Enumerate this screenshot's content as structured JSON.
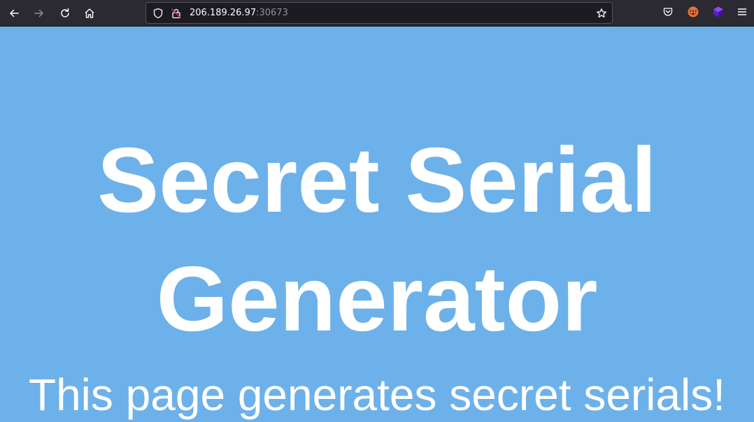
{
  "browser": {
    "url_host": "206.189.26.97",
    "url_port": ":30673",
    "icons": {
      "back": "arrow-left-icon",
      "forward": "arrow-right-icon",
      "reload": "reload-icon",
      "home": "home-icon",
      "tracking": "shield-icon",
      "security": "lock-insecure-icon",
      "bookmark": "star-icon",
      "pocket": "pocket-icon",
      "extension1": "fox-extension-icon",
      "extension2": "cube-extension-icon",
      "menu": "hamburger-menu-icon"
    },
    "colors": {
      "toolbar": "#2b2a33",
      "urlbar": "#1c1b22"
    }
  },
  "page": {
    "title": "Secret Serial Generator",
    "subtitle": "This page generates secret serials!",
    "background_color": "#6db1ea",
    "text_color": "#ffffff"
  }
}
